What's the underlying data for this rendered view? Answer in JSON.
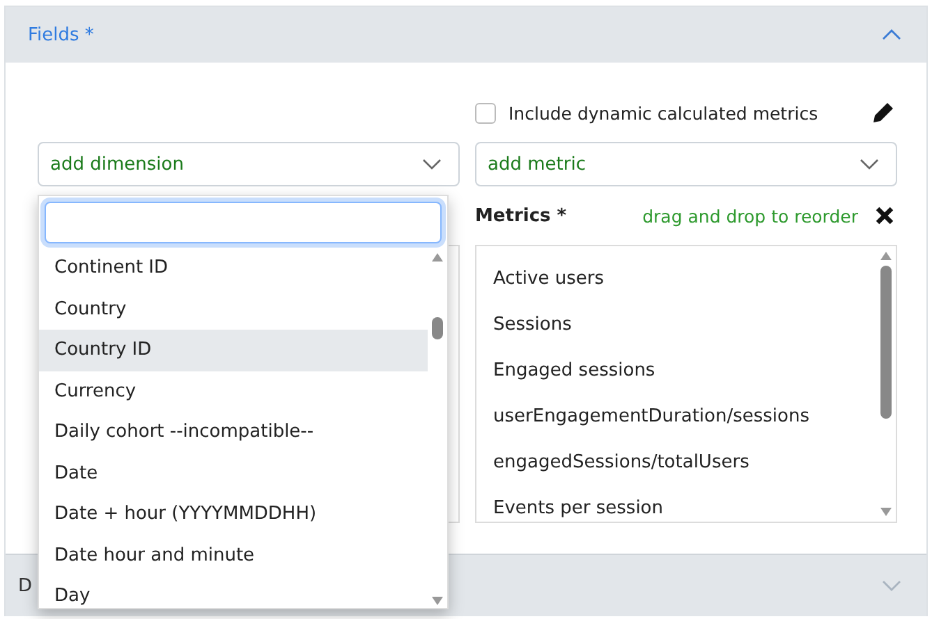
{
  "fields_section": {
    "title": "Fields *",
    "expanded": true
  },
  "include_dynamic": {
    "label": "Include dynamic calculated metrics",
    "checked": false
  },
  "dimension_select": {
    "value": "add dimension"
  },
  "metric_select": {
    "value": "add metric"
  },
  "metrics": {
    "title": "Metrics *",
    "hint": "drag and drop to reorder",
    "items": [
      "Active users",
      "Sessions",
      "Engaged sessions",
      "userEngagementDuration/sessions",
      "engagedSessions/totalUsers",
      "Events per session"
    ]
  },
  "dimension_dropdown": {
    "options": [
      {
        "label": "Continent ID",
        "selected": false
      },
      {
        "label": "Country",
        "selected": false
      },
      {
        "label": "Country ID",
        "selected": true
      },
      {
        "label": "Currency",
        "selected": false
      },
      {
        "label": "Daily cohort --incompatible--",
        "selected": false
      },
      {
        "label": "Date",
        "selected": false
      },
      {
        "label": "Date + hour (YYYYMMDDHH)",
        "selected": false
      },
      {
        "label": "Date hour and minute",
        "selected": false
      },
      {
        "label": "Day",
        "selected": false
      }
    ]
  },
  "next_section": {
    "title": "D",
    "expanded": false
  }
}
